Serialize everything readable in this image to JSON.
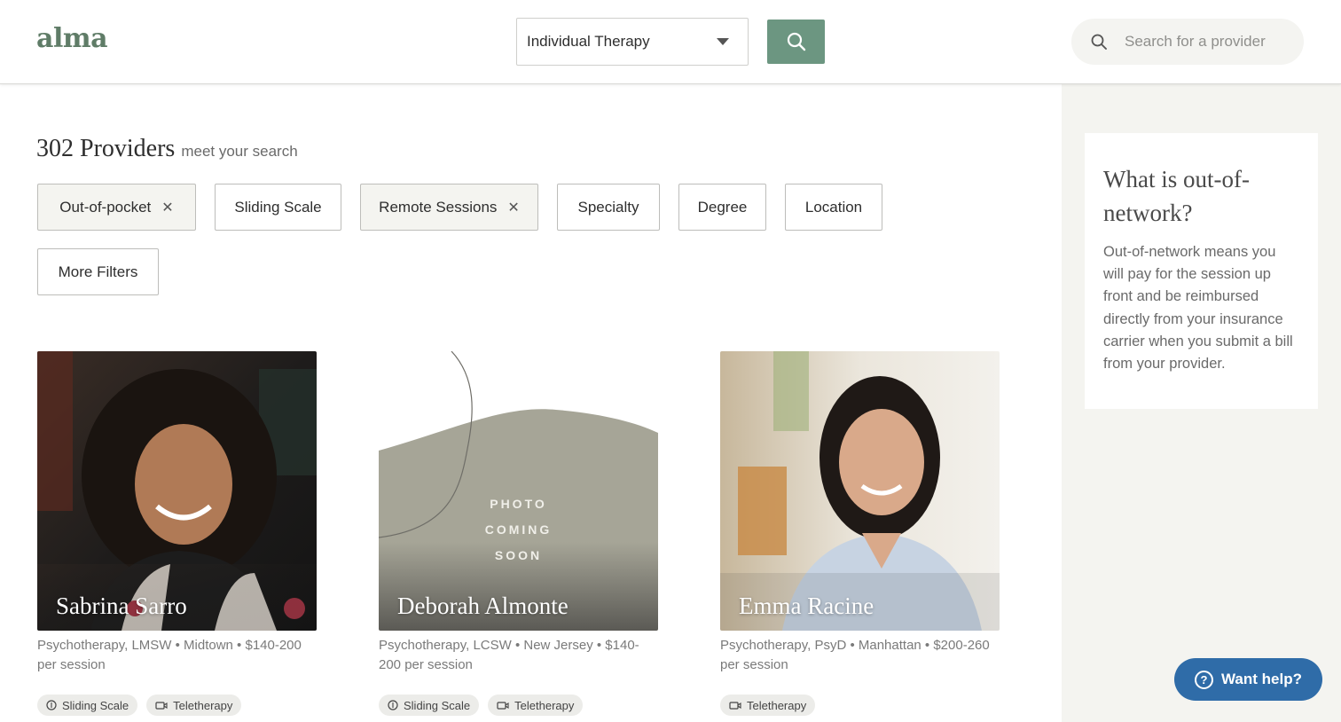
{
  "header": {
    "logo": "alma",
    "therapy_type": "Individual Therapy",
    "provider_search_placeholder": "Search for a provider"
  },
  "results": {
    "count": "302 Providers",
    "subtitle": "meet your search"
  },
  "filters": [
    {
      "label": "Out-of-pocket",
      "active": true,
      "removable": true
    },
    {
      "label": "Sliding Scale",
      "active": false,
      "removable": false
    },
    {
      "label": "Remote Sessions",
      "active": true,
      "removable": true
    },
    {
      "label": "Specialty",
      "active": false,
      "removable": false
    },
    {
      "label": "Degree",
      "active": false,
      "removable": false
    },
    {
      "label": "Location",
      "active": false,
      "removable": false
    },
    {
      "label": "More Filters",
      "active": false,
      "removable": false
    }
  ],
  "providers": [
    {
      "name": "Sabrina Sarro",
      "meta": "Psychotherapy, LMSW • Midtown • $140-200 per session",
      "tags": [
        "Sliding Scale",
        "Teletherapy"
      ]
    },
    {
      "name": "Deborah Almonte",
      "meta": "Psychotherapy, LCSW • New Jersey • $140-200 per session",
      "placeholder_lines": [
        "PHOTO",
        "COMING",
        "SOON"
      ],
      "tags": [
        "Sliding Scale",
        "Teletherapy"
      ]
    },
    {
      "name": "Emma Racine",
      "meta": "Psychotherapy, PsyD • Manhattan • $200-260 per session",
      "tags": [
        "Teletherapy"
      ]
    }
  ],
  "info_card": {
    "title": "What is out-of-network?",
    "body": "Out-of-network means you will pay for the session up front and be reimbursed directly from your insurance carrier when you submit a bill from your provider."
  },
  "help_button": {
    "label": "Want help?"
  },
  "colors": {
    "brand_green": "#5f7c67",
    "search_button": "#6c9681",
    "help_blue": "#2f6ca8",
    "side_panel": "#f4f4f0"
  }
}
